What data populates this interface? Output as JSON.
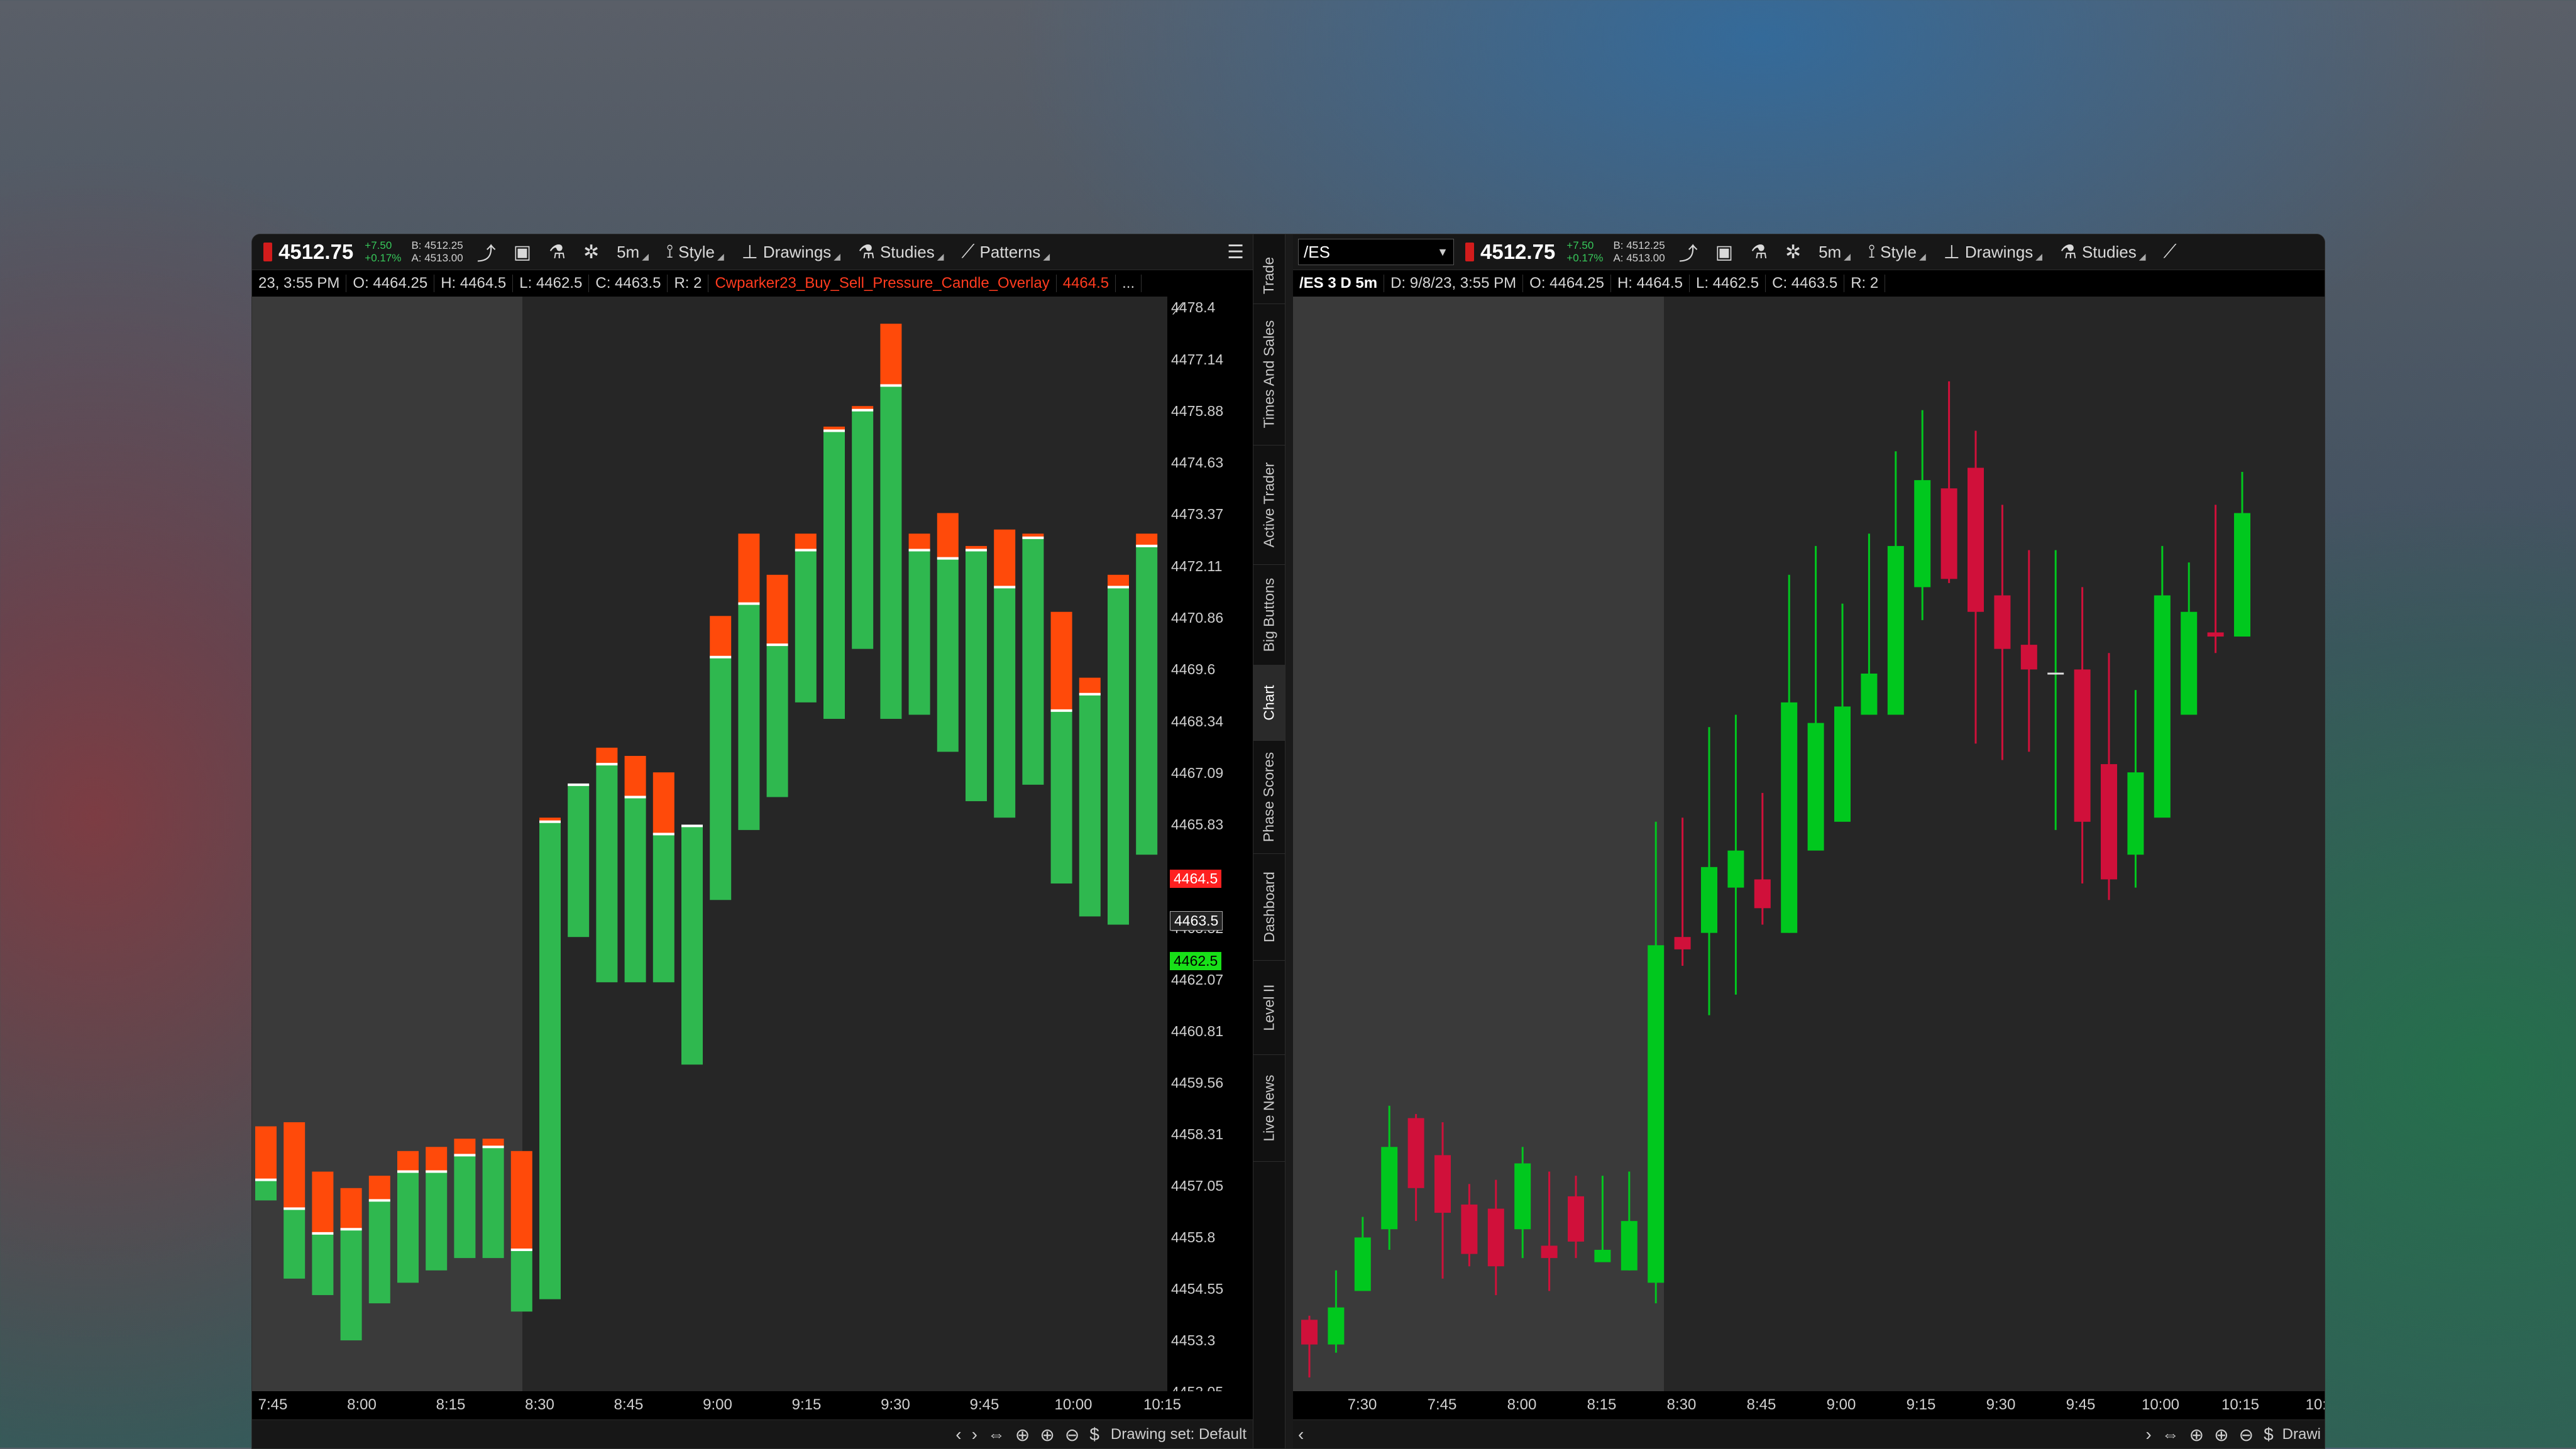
{
  "left": {
    "toolbar": {
      "price": "4512.75",
      "change": "+7.50",
      "change_pct": "+0.17%",
      "bid": "B: 4512.25",
      "ask": "A: 4513.00",
      "timeframe": "5m",
      "style": "Style",
      "drawings": "Drawings",
      "studies": "Studies",
      "patterns": "Patterns"
    },
    "info": {
      "date": "23, 3:55 PM",
      "open": "O: 4464.25",
      "high": "H: 4464.5",
      "low": "L: 4462.5",
      "close": "C: 4463.5",
      "range": "R: 2",
      "study_name": "Cwparker23_Buy_Sell_Pressure_Candle_Overlay",
      "study_value": "4464.5",
      "more": "..."
    },
    "yaxis": {
      "labels": [
        "4478.4",
        "4477.14",
        "4475.88",
        "4474.63",
        "4473.37",
        "4472.11",
        "4470.86",
        "4469.6",
        "4468.34",
        "4467.09",
        "4465.83",
        "4463.32",
        "4462.07",
        "4460.81",
        "4459.56",
        "4458.31",
        "4457.05",
        "4455.8",
        "4454.55",
        "4453.3",
        "4452.05"
      ],
      "tag_red": "4464.5",
      "tag_gray": "4463.5",
      "tag_green": "4462.5"
    },
    "xaxis": [
      "7:45",
      "8:00",
      "8:15",
      "8:30",
      "8:45",
      "9:00",
      "9:15",
      "9:30",
      "9:45",
      "10:00",
      "10:15"
    ],
    "status": {
      "drawing_set": "Drawing set: Default"
    }
  },
  "right": {
    "toolbar": {
      "symbol": "/ES",
      "price": "4512.75",
      "change": "+7.50",
      "change_pct": "+0.17%",
      "bid": "B: 4512.25",
      "ask": "A: 4513.00",
      "timeframe": "5m",
      "style": "Style",
      "drawings": "Drawings",
      "studies": "Studies"
    },
    "info": {
      "title": "/ES 3 D 5m",
      "date": "D: 9/8/23, 3:55 PM",
      "open": "O: 4464.25",
      "high": "H: 4464.5",
      "low": "L: 4462.5",
      "close": "C: 4463.5",
      "range": "R: 2"
    },
    "xaxis": [
      "7:30",
      "7:45",
      "8:00",
      "8:15",
      "8:30",
      "8:45",
      "9:00",
      "9:15",
      "9:30",
      "9:45",
      "10:00",
      "10:15",
      "10:3"
    ],
    "status": {
      "drawing_partial": "Drawi"
    }
  },
  "side_tabs": [
    "Trade",
    "Times And Sales",
    "Active Trader",
    "Big Buttons",
    "Chart",
    "Phase Scores",
    "Dashboard",
    "Level II",
    "Live News"
  ],
  "colors": {
    "buy_pressure": "#2fb84f",
    "sell_pressure": "#ff4a0a",
    "candle_up": "#00c81e",
    "candle_down": "#d0103a",
    "tag_red": "#ff2020",
    "tag_green": "#18e018"
  },
  "chart_data": [
    {
      "type": "bar",
      "title": "",
      "xlabel": "",
      "ylabel": "",
      "ylim": [
        4452.05,
        4478.4
      ],
      "categories": [
        "7:40",
        "7:45",
        "7:50",
        "7:55",
        "8:00",
        "8:05",
        "8:10",
        "8:15",
        "8:20",
        "8:25",
        "8:30",
        "8:35",
        "8:40",
        "8:45",
        "8:50",
        "8:55",
        "9:00",
        "9:05",
        "9:10",
        "9:15",
        "9:20",
        "9:25",
        "9:30",
        "9:35",
        "9:40",
        "9:45",
        "9:50",
        "9:55",
        "10:00",
        "10:05",
        "10:10",
        "10:15"
      ],
      "series": [
        {
          "values_open": [
            4457.2,
            4456.5,
            4455.9,
            4457.0,
            4456.7,
            4457.4,
            4458.0,
            4458.2,
            4458.0,
            4455.5,
            4466.0,
            4466.8,
            4467.3,
            4466.5,
            4465.6,
            4465.8,
            4469.9,
            4471.2,
            4470.2,
            4472.5,
            4475.5,
            4476.0,
            4476.5,
            4472.5,
            4473.4,
            4472.6,
            4473.0,
            4472.8,
            4468.6,
            4469.4,
            4471.9,
            4472.6
          ],
          "values_close": [
            4456.7,
            4454.8,
            4454.4,
            4453.3,
            4455.3,
            4454.7,
            4455.4,
            4456.0,
            4455.5,
            4454.0,
            4454.3,
            4463.5,
            4462.6,
            4462.9,
            4463.8,
            4460.0,
            4464.0,
            4465.7,
            4466.5,
            4470.5,
            4470.8,
            4473.5,
            4470.8,
            4471.2,
            4470.8,
            4467.4,
            4467.0,
            4467.4,
            4464.4,
            4465.4,
            4465.5,
            4470.8
          ],
          "values_high": [
            4458.5,
            4458.6,
            4457.4,
            4456.0,
            4457.3,
            4457.9,
            4457.4,
            4457.8,
            4458.2,
            4457.9,
            4465.9,
            4466.8,
            4467.7,
            4467.5,
            4467.1,
            4465.8,
            4470.9,
            4472.9,
            4471.9,
            4472.9,
            4475.4,
            4475.9,
            4478.0,
            4472.9,
            4472.3,
            4472.5,
            4471.6,
            4472.9,
            4471.0,
            4469.0,
            4471.6,
            4472.9
          ],
          "values_low": [
            4458.4,
            4455.3,
            4454.9,
            4454.4,
            4454.2,
            4455.0,
            4455.0,
            4455.3,
            4455.3,
            4454.8,
            4454.6,
            4463.1,
            4462.0,
            4462.0,
            4462.0,
            4461.8,
            4464.0,
            4465.7,
            4466.8,
            4468.8,
            4468.4,
            4470.1,
            4468.4,
            4468.5,
            4467.6,
            4466.4,
            4466.0,
            4466.8,
            4464.6,
            4463.6,
            4463.4,
            4465.1
          ]
        }
      ]
    },
    {
      "type": "bar",
      "title": "",
      "xlabel": "",
      "ylabel": "",
      "ylim": [
        4452.05,
        4478.4
      ],
      "categories": [
        "7:30",
        "7:35",
        "7:40",
        "7:45",
        "7:50",
        "7:55",
        "8:00",
        "8:05",
        "8:10",
        "8:15",
        "8:20",
        "8:25",
        "8:30",
        "8:35",
        "8:40",
        "8:45",
        "8:50",
        "8:55",
        "9:00",
        "9:05",
        "9:10",
        "9:15",
        "9:20",
        "9:25",
        "9:30",
        "9:35",
        "9:40",
        "9:45",
        "9:50",
        "9:55",
        "10:00",
        "10:05",
        "10:10",
        "10:15",
        "10:20",
        "10:25"
      ],
      "series": [
        {
          "name": "OHLC",
          "open": [
            4453.8,
            4453.2,
            4454.5,
            4456.0,
            4458.7,
            4457.8,
            4456.6,
            4456.5,
            4456.0,
            4455.6,
            4456.8,
            4455.2,
            4455.0,
            4454.7,
            4463.1,
            4463.2,
            4464.3,
            4464.5,
            4463.2,
            4465.2,
            4465.9,
            4468.5,
            4468.5,
            4471.6,
            4474.0,
            4474.5,
            4471.4,
            4470.2,
            4469.5,
            4469.6,
            4467.3,
            4465.1,
            4466.0,
            4468.5,
            4470.5,
            4470.4
          ],
          "close": [
            4453.2,
            4454.1,
            4455.8,
            4458.0,
            4457.0,
            4456.4,
            4455.4,
            4455.1,
            4457.6,
            4455.3,
            4455.7,
            4455.5,
            4456.2,
            4462.9,
            4462.8,
            4464.8,
            4465.2,
            4463.8,
            4468.8,
            4468.3,
            4468.7,
            4469.5,
            4472.6,
            4474.2,
            4471.8,
            4471.0,
            4470.1,
            4469.6,
            4469.5,
            4465.9,
            4464.5,
            4467.1,
            4471.4,
            4471.0,
            4470.4,
            4473.4
          ],
          "high": [
            4453.9,
            4455.0,
            4456.3,
            4459.0,
            4458.8,
            4458.6,
            4457.1,
            4457.2,
            4458.0,
            4457.4,
            4457.3,
            4457.3,
            4457.4,
            4465.9,
            4466.0,
            4468.2,
            4468.5,
            4466.6,
            4471.9,
            4472.6,
            4471.2,
            4472.9,
            4474.9,
            4475.9,
            4476.6,
            4475.4,
            4473.6,
            4472.5,
            4472.5,
            4471.6,
            4470.0,
            4469.1,
            4472.6,
            4472.2,
            4473.6,
            4474.4
          ],
          "low": [
            4452.4,
            4453.0,
            4454.6,
            4455.5,
            4456.2,
            4454.8,
            4455.1,
            4454.4,
            4455.3,
            4454.5,
            4455.3,
            4455.3,
            4455.0,
            4454.2,
            4462.4,
            4461.2,
            4461.7,
            4463.4,
            4463.2,
            4465.8,
            4466.4,
            4468.5,
            4469.8,
            4470.8,
            4471.7,
            4467.8,
            4467.4,
            4467.6,
            4465.7,
            4464.4,
            4464.0,
            4464.3,
            4466.1,
            4468.8,
            4470.0,
            4470.8
          ]
        }
      ]
    }
  ]
}
